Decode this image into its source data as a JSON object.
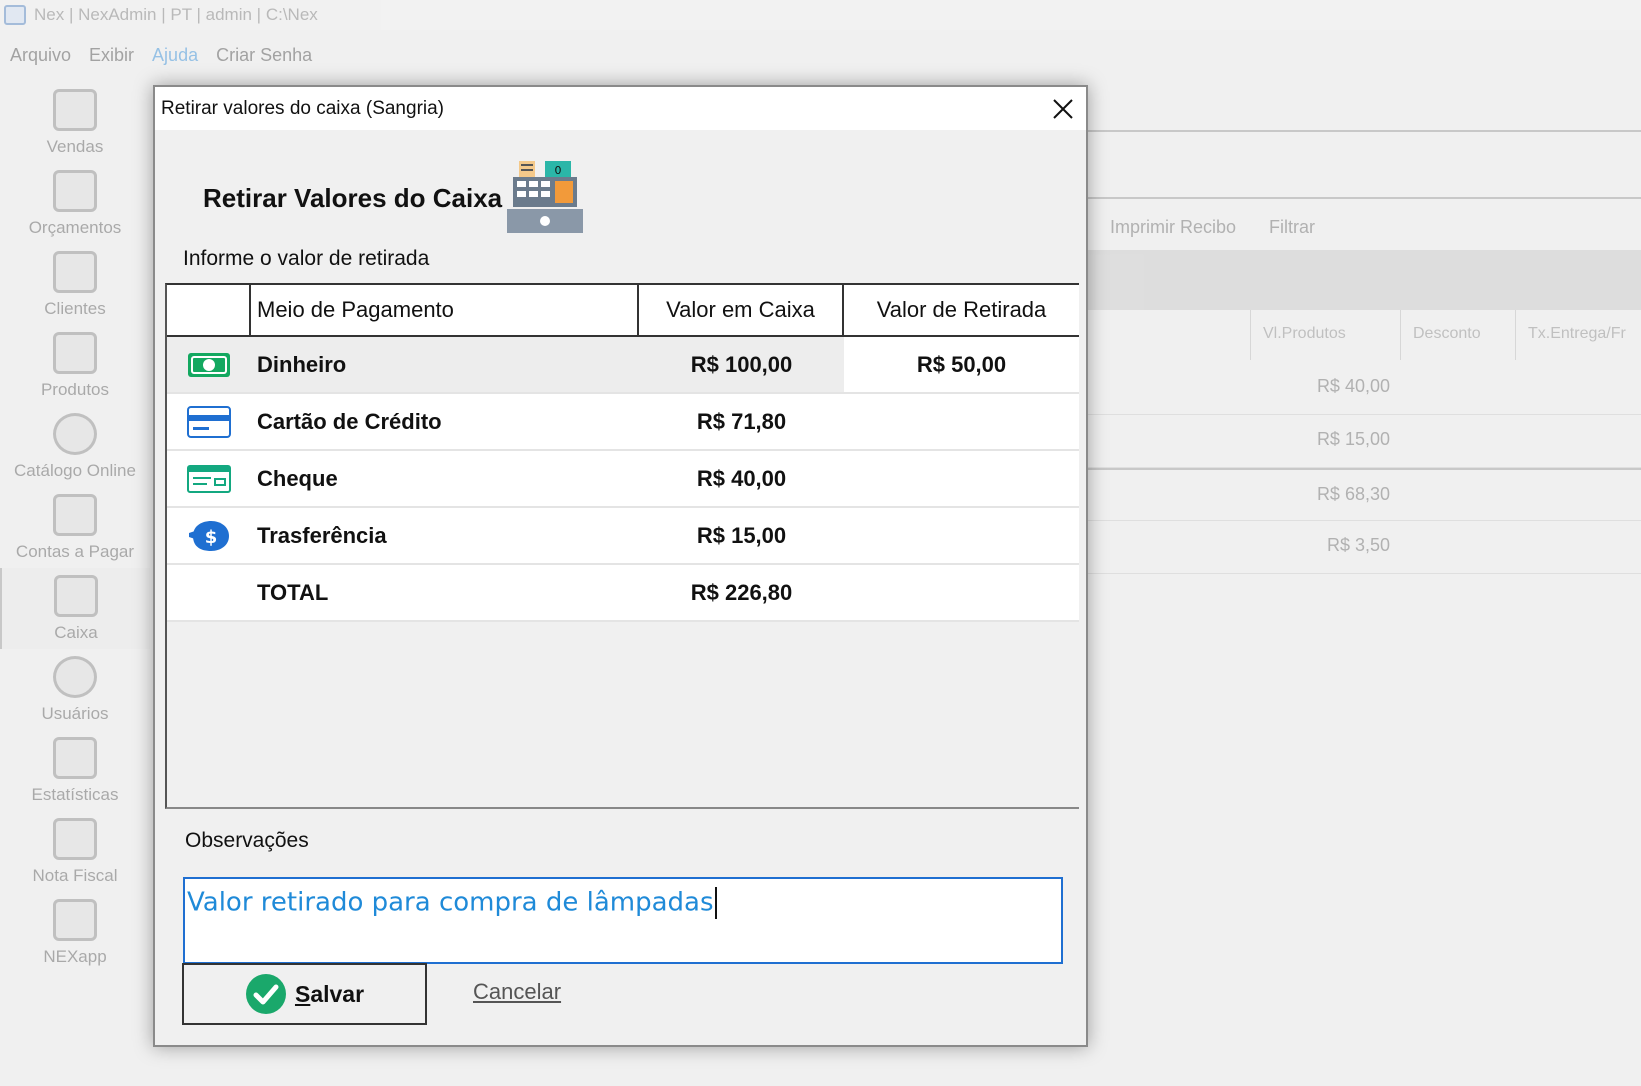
{
  "window": {
    "title": "Nex | NexAdmin | PT | admin | C:\\Nex"
  },
  "menu": {
    "items": [
      "Arquivo",
      "Exibir",
      "Ajuda",
      "Criar Senha"
    ],
    "active": "Ajuda"
  },
  "sidebar": {
    "items": [
      {
        "label": "Vendas",
        "icon": "cart-icon"
      },
      {
        "label": "Orçamentos",
        "icon": "document-icon"
      },
      {
        "label": "Clientes",
        "icon": "contacts-icon"
      },
      {
        "label": "Produtos",
        "icon": "box-icon"
      },
      {
        "label": "Catálogo Online",
        "icon": "globe-icon"
      },
      {
        "label": "Contas a Pagar",
        "icon": "bill-icon"
      },
      {
        "label": "Caixa",
        "icon": "register-icon"
      },
      {
        "label": "Usuários",
        "icon": "user-icon"
      },
      {
        "label": "Estatísticas",
        "icon": "chart-icon"
      },
      {
        "label": "Nota Fiscal",
        "icon": "qr-icon"
      },
      {
        "label": "NEXapp",
        "icon": "phone-icon"
      }
    ],
    "selected": "Caixa"
  },
  "background": {
    "toolbar": [
      "Imprimir Recibo",
      "Filtrar"
    ],
    "columns": [
      "Vl.Produtos",
      "Desconto",
      "Tx.Entrega/Fr"
    ],
    "values": [
      "R$ 40,00",
      "R$ 15,00",
      "R$ 68,30",
      "R$ 3,50"
    ]
  },
  "dialog": {
    "title": "Retirar valores do caixa (Sangria)",
    "header": "Retirar Valores do Caixa",
    "prompt": "Informe o valor de retirada",
    "columns": {
      "method": "Meio de Pagamento",
      "in_register": "Valor em Caixa",
      "withdrawal": "Valor de Retirada"
    },
    "rows": [
      {
        "icon": "cash-icon",
        "method": "Dinheiro",
        "in_register": "R$ 100,00",
        "withdrawal": "R$ 50,00"
      },
      {
        "icon": "credit-card-icon",
        "method": "Cartão de Crédito",
        "in_register": "R$ 71,80",
        "withdrawal": ""
      },
      {
        "icon": "cheque-icon",
        "method": "Cheque",
        "in_register": "R$ 40,00",
        "withdrawal": ""
      },
      {
        "icon": "piggy-bank-icon",
        "method": "Trasferência",
        "in_register": "R$ 15,00",
        "withdrawal": ""
      },
      {
        "icon": "",
        "method": "TOTAL",
        "in_register": "R$ 226,80",
        "withdrawal": ""
      }
    ],
    "notes_label": "Observações",
    "notes_value": "Valor retirado para compra de lâmpadas",
    "save_label_first": "S",
    "save_label_rest": "alvar",
    "cancel_label": "Cancelar"
  },
  "colors": {
    "accent": "#1f6fd1",
    "text_blue": "#1f8ad8",
    "cash_green": "#13a860",
    "success": "#1aa86b"
  }
}
